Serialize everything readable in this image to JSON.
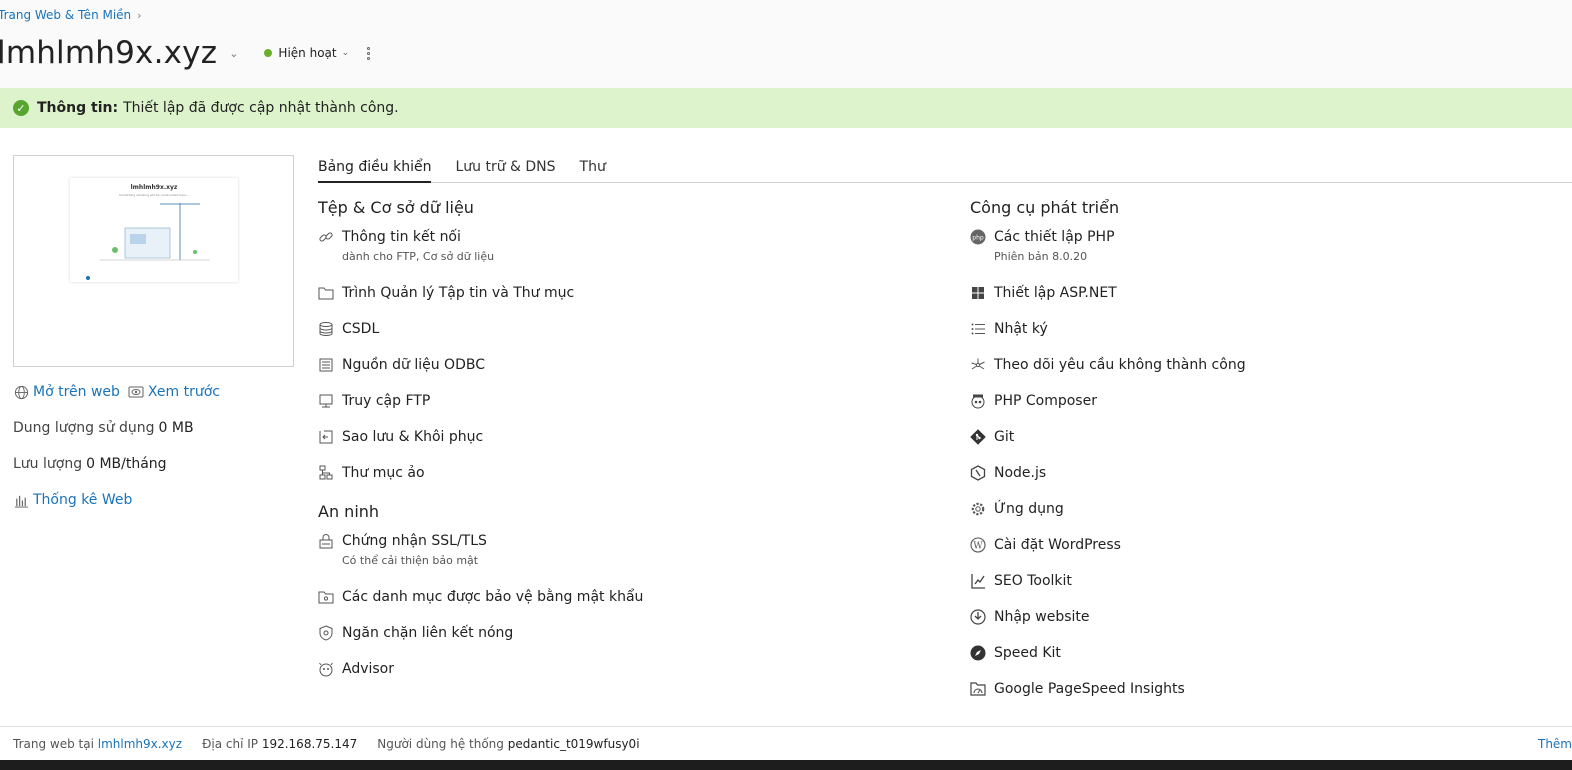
{
  "breadcrumb": {
    "label": "Trang Web & Tên Miền"
  },
  "header": {
    "title": "lmhlmh9x.xyz",
    "status": "Hiện hoạt"
  },
  "info": {
    "label": "Thông tin:",
    "message": "Thiết lập đã được cập nhật thành công."
  },
  "thumbnail": {
    "site_title": "lmhlmh9x.xyz",
    "subtitle": "Something amazing will be constructed here..."
  },
  "side": {
    "open_web": "Mở trên web",
    "preview": "Xem trước",
    "disk_label": "Dung lượng sử dụng",
    "disk_value": "0 MB",
    "traffic_label": "Lưu lượng",
    "traffic_value": "0 MB/tháng",
    "stats": "Thống kê Web"
  },
  "tabs": [
    "Bảng điều khiển",
    "Lưu trữ & DNS",
    "Thư"
  ],
  "col1": {
    "files_title": "Tệp & Cơ sở dữ liệu",
    "files": [
      {
        "label": "Thông tin kết nối",
        "sub": "dành cho FTP, Cơ sở dữ liệu",
        "icon": "link-icon"
      },
      {
        "label": "Trình Quản lý Tập tin và Thư mục",
        "icon": "folder-icon"
      },
      {
        "label": "CSDL",
        "icon": "database-icon"
      },
      {
        "label": "Nguồn dữ liệu ODBC",
        "icon": "odbc-icon"
      },
      {
        "label": "Truy cập FTP",
        "icon": "ftp-icon"
      },
      {
        "label": "Sao lưu & Khôi phục",
        "icon": "backup-icon"
      },
      {
        "label": "Thư mục ảo",
        "icon": "virtual-dir-icon"
      }
    ],
    "security_title": "An ninh",
    "security": [
      {
        "label": "Chứng nhận SSL/TLS",
        "sub": "Có thể cải thiện bảo mật",
        "icon": "ssl-icon"
      },
      {
        "label": "Các danh mục được bảo vệ bằng mật khẩu",
        "icon": "protected-folder-icon"
      },
      {
        "label": "Ngăn chặn liên kết nóng",
        "icon": "hotlink-icon"
      },
      {
        "label": "Advisor",
        "icon": "advisor-icon"
      }
    ]
  },
  "col2": {
    "dev_title": "Công cụ phát triển",
    "dev": [
      {
        "label": "Các thiết lập PHP",
        "sub": "Phiên bản 8.0.20",
        "icon": "php-icon"
      },
      {
        "label": "Thiết lập ASP.NET",
        "icon": "aspnet-icon"
      },
      {
        "label": "Nhật ký",
        "icon": "logs-icon"
      },
      {
        "label": "Theo dõi yêu cầu không thành công",
        "icon": "trace-icon"
      },
      {
        "label": "PHP Composer",
        "icon": "composer-icon"
      },
      {
        "label": "Git",
        "icon": "git-icon"
      },
      {
        "label": "Node.js",
        "icon": "nodejs-icon"
      },
      {
        "label": "Ứng dụng",
        "icon": "gear-icon"
      },
      {
        "label": "Cài đặt WordPress",
        "icon": "wordpress-icon"
      },
      {
        "label": "SEO Toolkit",
        "icon": "seo-icon"
      },
      {
        "label": "Nhập website",
        "icon": "import-icon"
      },
      {
        "label": "Speed Kit",
        "icon": "rocket-icon"
      },
      {
        "label": "Google PageSpeed Insights",
        "icon": "pagespeed-icon"
      }
    ]
  },
  "footer": {
    "site_label": "Trang web tại",
    "site_value": "lmhlmh9x.xyz",
    "ip_label": "Địa chỉ IP",
    "ip_value": "192.168.75.147",
    "user_label": "Người dùng hệ thống",
    "user_value": "pedantic_t019wfusy0i",
    "more": "Thêm"
  }
}
